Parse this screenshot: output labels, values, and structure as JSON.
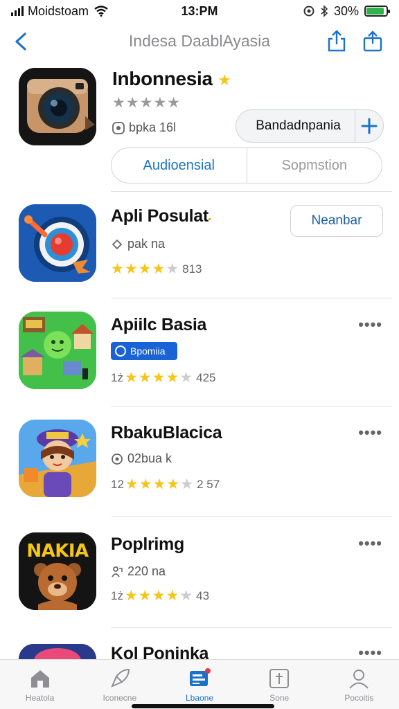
{
  "status": {
    "carrier": "Moidstoam",
    "time": "13:PM",
    "battery": "30%",
    "battery_level": 0.9,
    "icons": [
      "signal-icon",
      "wifi-icon",
      "location-icon",
      "bluetooth-icon",
      "battery-icon"
    ]
  },
  "nav": {
    "title": "Indesa DaablAyasia",
    "icons": [
      "back-chevron-icon",
      "share-icon",
      "export-icon"
    ]
  },
  "featured": {
    "name": "Inbonnesia",
    "stars": "★★★★★",
    "meta": "bpka 16l",
    "primary_button": "Bandadnpania",
    "add_icon": "plus-icon",
    "tabs": [
      "Audioensial",
      "Sopmstion"
    ]
  },
  "apps": [
    {
      "name": "Apli Posulat",
      "meta": "pak na",
      "stars": "★★★★★",
      "rating": "813",
      "action": "Neanbar",
      "icon": "paint-target-icon"
    },
    {
      "name": "Apiilc Basia",
      "badge": "Bpomiia",
      "stars": "★★★★★",
      "rating_prefix": "1ż",
      "rating": "425",
      "icon": "village-icon"
    },
    {
      "name": "RbakuBlacica",
      "meta": "02bua k",
      "stars": "★★★★★",
      "rating_prefix": "12",
      "rating": "2 57",
      "icon": "girl-character-icon"
    },
    {
      "name": "Poplrimg",
      "meta": "220 na",
      "stars": "★★★★★",
      "rating_prefix": "1ż",
      "rating": "43",
      "icon_text": "NAKIA",
      "icon": "bear-icon"
    },
    {
      "name": "Kol Ponjnka",
      "icon": "partial-app-icon"
    }
  ],
  "more_label": "••••",
  "tabbar": [
    {
      "label": "Heatola",
      "icon": "home-icon"
    },
    {
      "label": "Iconecne",
      "icon": "rocket-icon"
    },
    {
      "label": "Lbaone",
      "icon": "apps-icon"
    },
    {
      "label": "Sone",
      "icon": "search-box-icon"
    },
    {
      "label": "Pocoitis",
      "icon": "person-icon"
    }
  ],
  "colors": {
    "accent": "#1a73c9",
    "star": "#f5c518",
    "badge": "#1a63d6"
  }
}
